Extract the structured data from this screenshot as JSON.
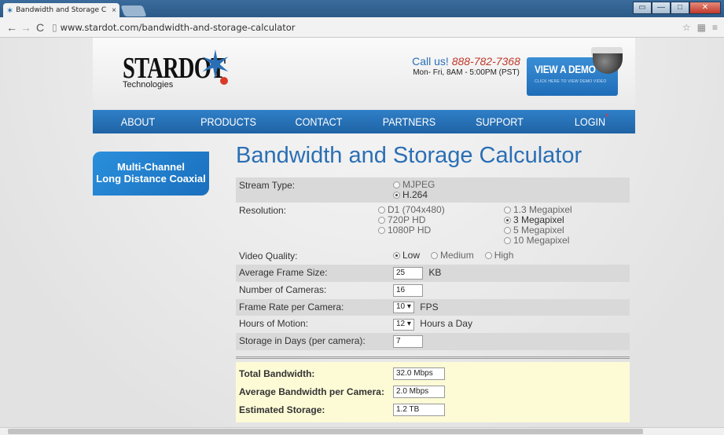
{
  "browser": {
    "tab_title": "Bandwidth and Storage C",
    "tab_close": "×",
    "url": "www.stardot.com/bandwidth-and-storage-calculator",
    "back_icon": "←",
    "forward_icon": "→",
    "reload_icon": "C",
    "window_buttons": [
      "▭",
      "—",
      "□",
      "✕"
    ]
  },
  "header": {
    "logo_word": "STARDOT",
    "logo_sub": "Technologies",
    "call_prefix": "Call us!",
    "phone": "888-782-7368",
    "hours": "Mon- Fri, 8AM - 5:00PM (PST)",
    "demo_title": "VIEW A DEMO",
    "demo_sub": "CLICK HERE TO VIEW DEMO VIDEO"
  },
  "nav": {
    "items": [
      "ABOUT",
      "PRODUCTS",
      "CONTACT",
      "PARTNERS",
      "SUPPORT",
      "LOGIN"
    ],
    "login_star": "*"
  },
  "sidebar": {
    "button_line1": "Multi-Channel",
    "button_line2": "Long Distance Coaxial"
  },
  "page": {
    "title": "Bandwidth and Storage Calculator"
  },
  "form": {
    "stream_type": {
      "label": "Stream Type:",
      "options": [
        "MJPEG",
        "H.264"
      ],
      "selected": "H.264"
    },
    "resolution": {
      "label": "Resolution:",
      "col1": [
        "D1 (704x480)",
        "720P HD",
        "1080P HD"
      ],
      "col2": [
        "1.3 Megapixel",
        "3 Megapixel",
        "5 Megapixel",
        "10 Megapixel"
      ],
      "selected": "3 Megapixel"
    },
    "video_quality": {
      "label": "Video Quality:",
      "options": [
        "Low",
        "Medium",
        "High"
      ],
      "selected": "Low"
    },
    "avg_frame_size": {
      "label": "Average Frame Size:",
      "value": "25",
      "unit": "KB"
    },
    "num_cameras": {
      "label": "Number of Cameras:",
      "value": "16"
    },
    "frame_rate": {
      "label": "Frame Rate per Camera:",
      "value": "10",
      "unit": "FPS"
    },
    "hours_motion": {
      "label": "Hours of Motion:",
      "value": "12",
      "unit": "Hours a Day"
    },
    "storage_days": {
      "label": "Storage in Days (per camera):",
      "value": "7"
    }
  },
  "results": {
    "total_bandwidth": {
      "label": "Total Bandwidth:",
      "value": "32.0 Mbps"
    },
    "avg_bandwidth": {
      "label": "Average Bandwidth per Camera:",
      "value": "2.0 Mbps"
    },
    "est_storage": {
      "label": "Estimated Storage:",
      "value": "1.2 TB"
    }
  }
}
